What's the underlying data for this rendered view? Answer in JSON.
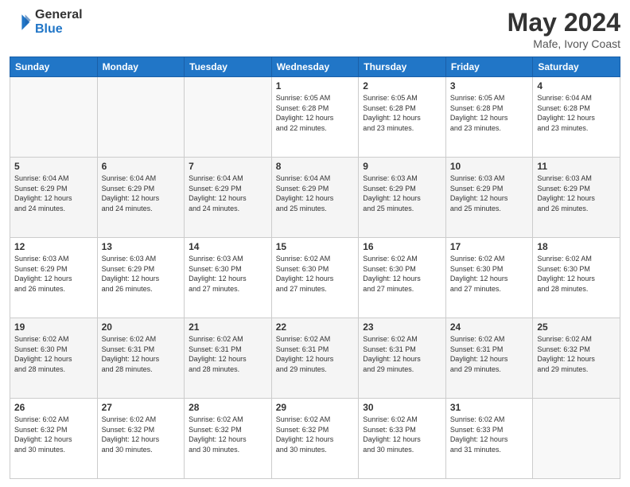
{
  "header": {
    "logo_line1": "General",
    "logo_line2": "Blue",
    "month": "May 2024",
    "location": "Mafe, Ivory Coast"
  },
  "days_of_week": [
    "Sunday",
    "Monday",
    "Tuesday",
    "Wednesday",
    "Thursday",
    "Friday",
    "Saturday"
  ],
  "weeks": [
    [
      {
        "day": "",
        "info": ""
      },
      {
        "day": "",
        "info": ""
      },
      {
        "day": "",
        "info": ""
      },
      {
        "day": "1",
        "info": "Sunrise: 6:05 AM\nSunset: 6:28 PM\nDaylight: 12 hours\nand 22 minutes."
      },
      {
        "day": "2",
        "info": "Sunrise: 6:05 AM\nSunset: 6:28 PM\nDaylight: 12 hours\nand 23 minutes."
      },
      {
        "day": "3",
        "info": "Sunrise: 6:05 AM\nSunset: 6:28 PM\nDaylight: 12 hours\nand 23 minutes."
      },
      {
        "day": "4",
        "info": "Sunrise: 6:04 AM\nSunset: 6:28 PM\nDaylight: 12 hours\nand 23 minutes."
      }
    ],
    [
      {
        "day": "5",
        "info": "Sunrise: 6:04 AM\nSunset: 6:29 PM\nDaylight: 12 hours\nand 24 minutes."
      },
      {
        "day": "6",
        "info": "Sunrise: 6:04 AM\nSunset: 6:29 PM\nDaylight: 12 hours\nand 24 minutes."
      },
      {
        "day": "7",
        "info": "Sunrise: 6:04 AM\nSunset: 6:29 PM\nDaylight: 12 hours\nand 24 minutes."
      },
      {
        "day": "8",
        "info": "Sunrise: 6:04 AM\nSunset: 6:29 PM\nDaylight: 12 hours\nand 25 minutes."
      },
      {
        "day": "9",
        "info": "Sunrise: 6:03 AM\nSunset: 6:29 PM\nDaylight: 12 hours\nand 25 minutes."
      },
      {
        "day": "10",
        "info": "Sunrise: 6:03 AM\nSunset: 6:29 PM\nDaylight: 12 hours\nand 25 minutes."
      },
      {
        "day": "11",
        "info": "Sunrise: 6:03 AM\nSunset: 6:29 PM\nDaylight: 12 hours\nand 26 minutes."
      }
    ],
    [
      {
        "day": "12",
        "info": "Sunrise: 6:03 AM\nSunset: 6:29 PM\nDaylight: 12 hours\nand 26 minutes."
      },
      {
        "day": "13",
        "info": "Sunrise: 6:03 AM\nSunset: 6:29 PM\nDaylight: 12 hours\nand 26 minutes."
      },
      {
        "day": "14",
        "info": "Sunrise: 6:03 AM\nSunset: 6:30 PM\nDaylight: 12 hours\nand 27 minutes."
      },
      {
        "day": "15",
        "info": "Sunrise: 6:02 AM\nSunset: 6:30 PM\nDaylight: 12 hours\nand 27 minutes."
      },
      {
        "day": "16",
        "info": "Sunrise: 6:02 AM\nSunset: 6:30 PM\nDaylight: 12 hours\nand 27 minutes."
      },
      {
        "day": "17",
        "info": "Sunrise: 6:02 AM\nSunset: 6:30 PM\nDaylight: 12 hours\nand 27 minutes."
      },
      {
        "day": "18",
        "info": "Sunrise: 6:02 AM\nSunset: 6:30 PM\nDaylight: 12 hours\nand 28 minutes."
      }
    ],
    [
      {
        "day": "19",
        "info": "Sunrise: 6:02 AM\nSunset: 6:30 PM\nDaylight: 12 hours\nand 28 minutes."
      },
      {
        "day": "20",
        "info": "Sunrise: 6:02 AM\nSunset: 6:31 PM\nDaylight: 12 hours\nand 28 minutes."
      },
      {
        "day": "21",
        "info": "Sunrise: 6:02 AM\nSunset: 6:31 PM\nDaylight: 12 hours\nand 28 minutes."
      },
      {
        "day": "22",
        "info": "Sunrise: 6:02 AM\nSunset: 6:31 PM\nDaylight: 12 hours\nand 29 minutes."
      },
      {
        "day": "23",
        "info": "Sunrise: 6:02 AM\nSunset: 6:31 PM\nDaylight: 12 hours\nand 29 minutes."
      },
      {
        "day": "24",
        "info": "Sunrise: 6:02 AM\nSunset: 6:31 PM\nDaylight: 12 hours\nand 29 minutes."
      },
      {
        "day": "25",
        "info": "Sunrise: 6:02 AM\nSunset: 6:32 PM\nDaylight: 12 hours\nand 29 minutes."
      }
    ],
    [
      {
        "day": "26",
        "info": "Sunrise: 6:02 AM\nSunset: 6:32 PM\nDaylight: 12 hours\nand 30 minutes."
      },
      {
        "day": "27",
        "info": "Sunrise: 6:02 AM\nSunset: 6:32 PM\nDaylight: 12 hours\nand 30 minutes."
      },
      {
        "day": "28",
        "info": "Sunrise: 6:02 AM\nSunset: 6:32 PM\nDaylight: 12 hours\nand 30 minutes."
      },
      {
        "day": "29",
        "info": "Sunrise: 6:02 AM\nSunset: 6:32 PM\nDaylight: 12 hours\nand 30 minutes."
      },
      {
        "day": "30",
        "info": "Sunrise: 6:02 AM\nSunset: 6:33 PM\nDaylight: 12 hours\nand 30 minutes."
      },
      {
        "day": "31",
        "info": "Sunrise: 6:02 AM\nSunset: 6:33 PM\nDaylight: 12 hours\nand 31 minutes."
      },
      {
        "day": "",
        "info": ""
      }
    ]
  ]
}
